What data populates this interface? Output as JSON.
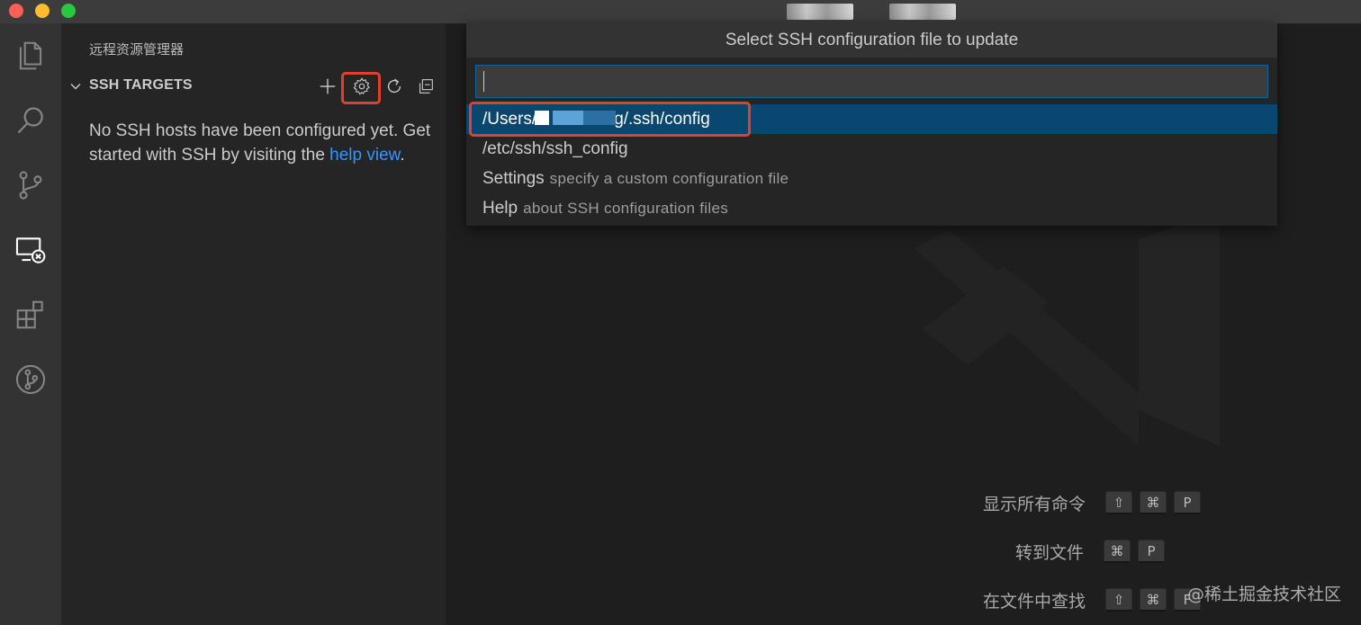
{
  "sidebar": {
    "title": "远程资源管理器",
    "section_title": "SSH TARGETS",
    "empty_message": "No SSH hosts have been configured yet. Get started with SSH by visiting the",
    "empty_link": "help view",
    "empty_suffix": "."
  },
  "quickpick": {
    "title": "Select SSH configuration file to update",
    "input_value": "",
    "items": [
      {
        "label_prefix": "/Users/",
        "label_suffix": "g/.ssh/config",
        "description": ""
      },
      {
        "label": "/etc/ssh/ssh_config",
        "description": ""
      },
      {
        "label": "Settings",
        "description": "specify a custom configuration file"
      },
      {
        "label": "Help",
        "description": "about SSH configuration files"
      }
    ]
  },
  "shortcuts": [
    {
      "label": "显示所有命令",
      "keys": [
        "⇧",
        "⌘",
        "P"
      ]
    },
    {
      "label": "转到文件",
      "keys": [
        "⌘",
        "P"
      ]
    },
    {
      "label": "在文件中查找",
      "keys": [
        "⇧",
        "⌘",
        "F"
      ]
    }
  ],
  "watermark": "@稀土掘金技术社区",
  "colors": {
    "accent": "#3794ff",
    "selection": "#094771",
    "highlight_box": "#e0412e"
  },
  "icons": {
    "activity_bar": [
      "files-icon",
      "search-icon",
      "source-control-icon",
      "remote-explorer-icon",
      "extensions-icon",
      "git-graph-icon"
    ],
    "section_actions": [
      "plus-icon",
      "gear-icon",
      "refresh-icon",
      "collapse-all-icon"
    ]
  }
}
